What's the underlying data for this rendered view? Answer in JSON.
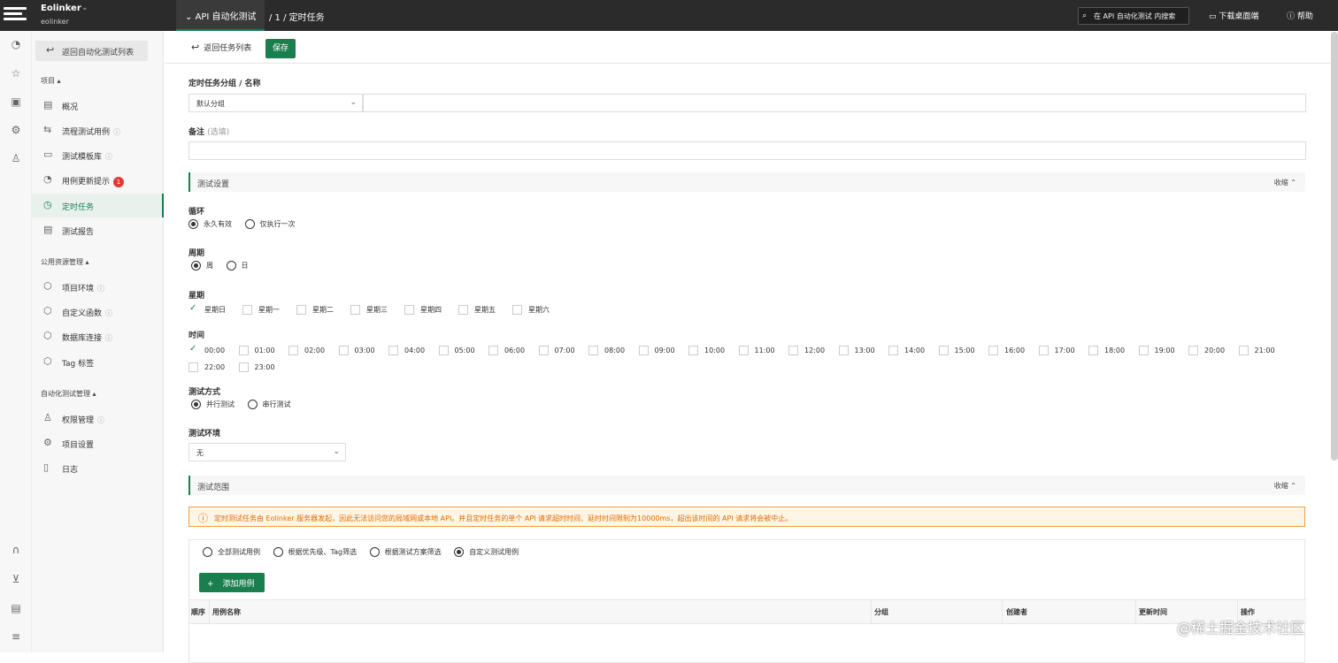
{
  "topbar": {
    "workspace_name": "Eolinker",
    "workspace_sub": "eolinker",
    "crumb_active": "API 自动化测试",
    "crumb_rest": "/ 1 / 定时任务",
    "search_placeholder": "在 API 自动化测试 内搜索",
    "download_label": "下载桌面端",
    "help_label": "帮助"
  },
  "sidebar": {
    "back_label": "返回自动化测试列表",
    "group_project": "项目",
    "group_public": "公用资源管理",
    "group_auto": "自动化测试管理",
    "project_items": [
      {
        "label": "概况"
      },
      {
        "label": "流程测试用例"
      },
      {
        "label": "测试模板库"
      },
      {
        "label": "用例更新提示",
        "badge": "1"
      },
      {
        "label": "定时任务"
      },
      {
        "label": "测试报告"
      }
    ],
    "public_items": [
      {
        "label": "项目环境"
      },
      {
        "label": "自定义函数"
      },
      {
        "label": "数据库连接"
      },
      {
        "label": "Tag 标签"
      }
    ],
    "auto_items": [
      {
        "label": "权限管理"
      },
      {
        "label": "项目设置"
      },
      {
        "label": "日志"
      }
    ]
  },
  "toolbar": {
    "back_label": "返回任务列表",
    "save_label": "保存"
  },
  "form": {
    "group_name_label": "定时任务分组 / 名称",
    "group_select_value": "默认分组",
    "remark_label": "备注",
    "remark_optional": "(选填)",
    "settings_section": "测试设置",
    "collapse_label": "收缩",
    "loop_label": "循环",
    "loop_options": [
      "永久有效",
      "仅执行一次"
    ],
    "period_label": "周期",
    "period_options": [
      "周",
      "日"
    ],
    "week_label": "星期",
    "week_days": [
      "星期日",
      "星期一",
      "星期二",
      "星期三",
      "星期四",
      "星期五",
      "星期六"
    ],
    "time_label": "时间",
    "times": [
      "00:00",
      "01:00",
      "02:00",
      "03:00",
      "04:00",
      "05:00",
      "06:00",
      "07:00",
      "08:00",
      "09:00",
      "10:00",
      "11:00",
      "12:00",
      "13:00",
      "14:00",
      "15:00",
      "16:00",
      "17:00",
      "18:00",
      "19:00",
      "20:00",
      "21:00",
      "22:00",
      "23:00"
    ],
    "mode_label": "测试方式",
    "mode_options": [
      "并行测试",
      "串行测试"
    ],
    "env_label": "测试环境",
    "env_value": "无",
    "scope_section": "测试范围",
    "warning": "定时测试任务由 Eolinker 服务器发起，因此无法访问您的局域网或本地 API。并且定时任务的单个 API 请求超时时间、延时时间限制为10000ms，超出该时间的 API 请求将会被中止。",
    "scope_options": [
      "全部测试用例",
      "根据优先级、Tag筛选",
      "根据测试方案筛选",
      "自定义测试用例"
    ],
    "add_case_label": "添加用例",
    "table_headers": [
      "顺序",
      "用例名称",
      "分组",
      "创建者",
      "更新时间",
      "操作"
    ]
  },
  "watermark": "@稀土掘金技术社区"
}
